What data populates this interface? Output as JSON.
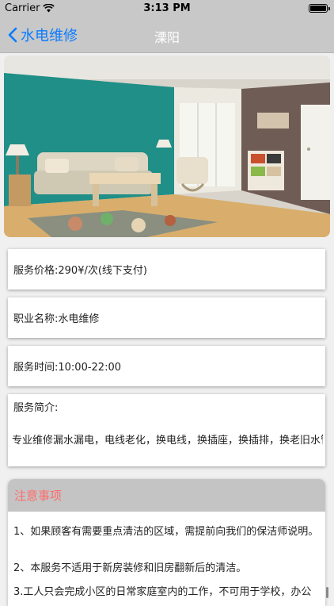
{
  "status_bar": {
    "carrier": "Carrier",
    "time": "3:13 PM",
    "battery_level": 1.0
  },
  "nav": {
    "back_label": "水电维修",
    "title": "溧阳"
  },
  "hero": {
    "icon": "living-room-photo"
  },
  "cards": {
    "price": "服务价格:290¥/次(线下支付)",
    "job_name": "职业名称:水电维修",
    "service_time": "服务时间:10:00-22:00",
    "intro_label": "服务简介:",
    "intro_text": "专业维修漏水漏电，电线老化，换电线，换插座，换插排，换老旧水管"
  },
  "notice": {
    "title": "注意事项",
    "items": [
      "1、如果顾客有需要重点清洁的区域，需提前向我们的保洁师说明。",
      "2、本服务不适用于新房装修和旧房翻新后的清洁。",
      "3.工人只会完成小区的日常家庭室内的工作，不可用于学校，办公"
    ]
  },
  "colors": {
    "nav_bg": "#c8c8c8",
    "back_blue": "#0a7bff",
    "notice_title": "#ff6b6b"
  }
}
